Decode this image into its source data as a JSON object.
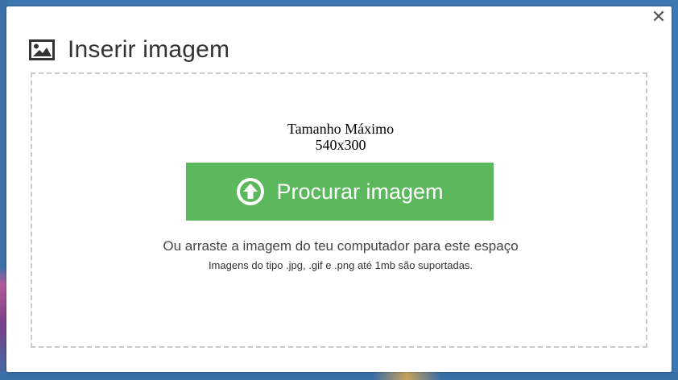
{
  "dialog": {
    "title": "Inserir imagem",
    "close_glyph": "✕",
    "title_icon": "image-icon"
  },
  "dropzone": {
    "max_size_label": "Tamanho Máximo",
    "max_size_value": "540x300",
    "browse_button_label": "Procurar imagem",
    "browse_icon": "arrow-up-circle-icon",
    "drag_hint": "Ou arraste a imagem do teu computador para este espaço",
    "formats_hint": "Imagens do tipo .jpg, .gif e .png até 1mb são suportadas."
  },
  "colors": {
    "browse_button": "#5cb85c",
    "dropzone_border": "#c9c9c9",
    "backdrop": "#3d78b3"
  }
}
